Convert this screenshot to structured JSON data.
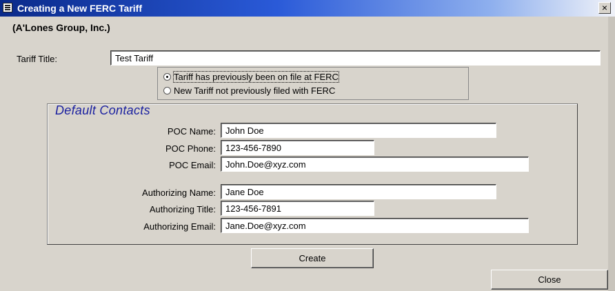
{
  "window": {
    "title": "Creating a New FERC Tariff",
    "close_label": "×"
  },
  "group_name": "(A'Lones Group, Inc.)",
  "tariff": {
    "label": "Tariff Title:",
    "value": "Test Tariff"
  },
  "radio": {
    "options": [
      {
        "label": "Tariff has previously been on file at FERC",
        "checked": true
      },
      {
        "label": "New Tariff not previously filed with FERC",
        "checked": false
      }
    ]
  },
  "contacts": {
    "title": "Default Contacts",
    "fields": [
      {
        "label": "POC Name:",
        "value": "John Doe"
      },
      {
        "label": "POC Phone:",
        "value": "123-456-7890"
      },
      {
        "label": "POC Email:",
        "value": "John.Doe@xyz.com"
      },
      {
        "label": "Authorizing Name:",
        "value": "Jane Doe"
      },
      {
        "label": "Authorizing Title:",
        "value": "123-456-7891"
      },
      {
        "label": "Authorizing Email:",
        "value": "Jane.Doe@xyz.com"
      }
    ]
  },
  "buttons": {
    "create": "Create",
    "close": "Close"
  }
}
